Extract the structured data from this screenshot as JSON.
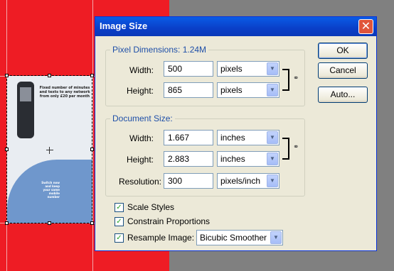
{
  "dialog": {
    "title": "Image Size",
    "close_glyph": "✕",
    "buttons": {
      "ok": "OK",
      "cancel": "Cancel",
      "auto": "Auto..."
    }
  },
  "pixel_dimensions": {
    "heading": "Pixel Dimensions:  1.24M",
    "width_label": "Width:",
    "width_value": "500",
    "width_unit": "pixels",
    "height_label": "Height:",
    "height_value": "865",
    "height_unit": "pixels"
  },
  "document_size": {
    "heading": "Document Size:",
    "width_label": "Width:",
    "width_value": "1.667",
    "width_unit": "inches",
    "height_label": "Height:",
    "height_value": "2.883",
    "height_unit": "inches",
    "resolution_label": "Resolution:",
    "resolution_value": "300",
    "resolution_unit": "pixels/inch"
  },
  "options": {
    "scale_styles": {
      "label": "Scale Styles",
      "checked": true
    },
    "constrain_proportions": {
      "label": "Constrain Proportions",
      "checked": true
    },
    "resample_image": {
      "label": "Resample Image:",
      "checked": true,
      "method": "Bicubic Smoother"
    }
  },
  "document_preview": {
    "headline": "Fixed number of minutes and texts to any network from only £20 per month",
    "side_text": "Switch now and keep your same mobile number"
  },
  "icons": {
    "dropdown": "chevron-down-icon",
    "chain": "chain-link-icon",
    "checkmark": "checkmark-icon"
  },
  "colors": {
    "canvas_red": "#ee1c24",
    "title_bar": "#0a5ce6",
    "group_heading": "#1e4fa8"
  }
}
